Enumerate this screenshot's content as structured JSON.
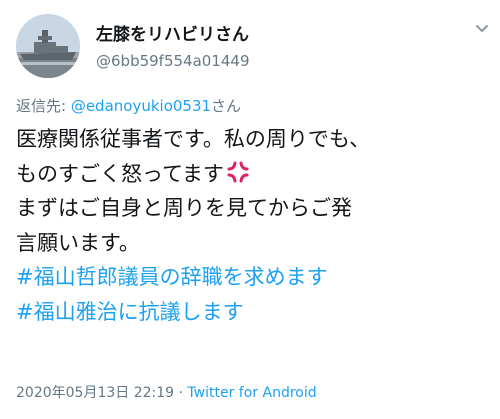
{
  "profile": {
    "display_name": "左膝をリハビリさん",
    "handle": "@6bb59f554a01449",
    "avatar_icon": "avatar-warship-photo"
  },
  "reply": {
    "prefix": "返信先: ",
    "mention": "@edanoyukio0531",
    "suffix": "さん"
  },
  "tweet": {
    "line1": "医療関係従事者です。私の周りでも、",
    "line2": "ものすごく怒ってます",
    "line2_emoji": "anger-symbol-icon",
    "line3": "まずはご自身と周りを見てからご発",
    "line4": "言願います。",
    "hashtag1": "#福山哲郎議員の辞職を求めます",
    "hashtag2": "#福山雅治に抗議します"
  },
  "meta": {
    "timestamp": "2020年05月13日 22:19",
    "separator": " · ",
    "client": "Twitter for Android"
  },
  "colors": {
    "link": "#1da1f2",
    "secondary_text": "#657786",
    "primary_text": "#14171a",
    "anger_emoji": "#e0245e"
  }
}
